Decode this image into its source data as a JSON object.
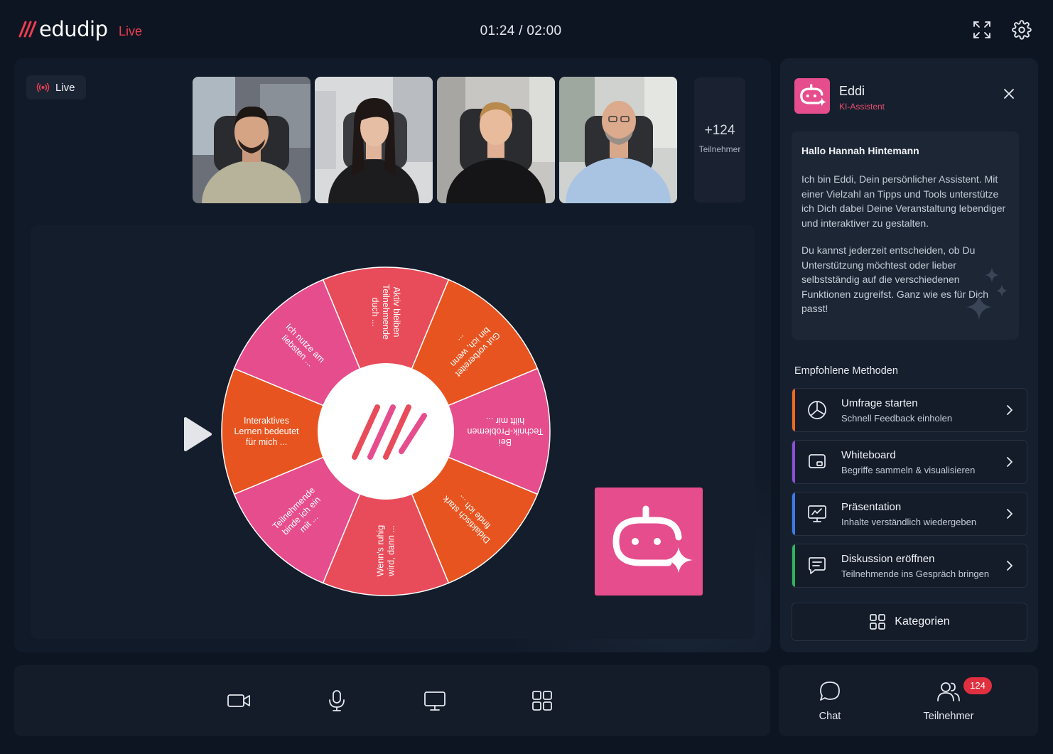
{
  "header": {
    "logo_text": "edudip",
    "live_label": "Live",
    "timer": "01:24 / 02:00",
    "fullscreen_icon": "fullscreen-icon",
    "settings_icon": "gear-icon"
  },
  "stage": {
    "live_badge": "Live",
    "more_participants": {
      "count": "+124",
      "label": "Teilnehmer"
    },
    "wheel_segments": [
      "Aktiv bleiben Teilnehmende duch ...",
      "Gut vorbereitet bin ich, wenn ...",
      "Bei Technik-Problemen hilft mir ...",
      "Didaktisch stark finde ich ...",
      "Wenn's ruhig wird, dann ...",
      "Teilnehmende binde ich ein mit ...",
      "Interaktives Lernen bedeutet für mich ...",
      "Ich nutze am liebsten ..."
    ]
  },
  "toolbar": {
    "buttons": [
      "camera-icon",
      "microphone-icon",
      "screen-share-icon",
      "apps-grid-icon"
    ]
  },
  "assistant": {
    "name": "Eddi",
    "role": "KI-Assistent",
    "greeting_title": "Hallo Hannah Hintemann",
    "greeting_p1": "Ich bin Eddi, Dein persönlicher Assistent. Mit einer Vielzahl an Tipps und Tools unterstütze ich Dich dabei Deine Veranstaltung lebendiger und interaktiver zu gestalten.",
    "greeting_p2": "Du kannst jederzeit entscheiden, ob Du Unterstützung möchtest oder lieber selbstständig auf die verschiedenen Funktionen zugreifst. Ganz wie es für Dich passt!",
    "section_title": "Empfohlene Methoden",
    "methods": [
      {
        "title": "Umfrage starten",
        "subtitle": "Schnell Feedback einholen",
        "icon": "pie-chart-icon",
        "accent": "#f06a1e"
      },
      {
        "title": "Whiteboard",
        "subtitle": "Begriffe sammeln & visualisieren",
        "icon": "whiteboard-icon",
        "accent": "#8c4fd6"
      },
      {
        "title": "Präsentation",
        "subtitle": "Inhalte verständlich wiedergeben",
        "icon": "presentation-icon",
        "accent": "#3b7be8"
      },
      {
        "title": "Diskussion eröffnen",
        "subtitle": "Teilnehmende ins Gespräch bringen",
        "icon": "chat-bubble-icon",
        "accent": "#2fb35c"
      }
    ],
    "categories_label": "Kategorien"
  },
  "bottom_right": {
    "chat_label": "Chat",
    "participants_label": "Teilnehmer",
    "participants_badge": "124"
  },
  "colors": {
    "brand_pink": "#e64d8c",
    "live_red": "#ef3d4f",
    "wheel_red": "#e84c5a",
    "wheel_orange": "#e8541f",
    "wheel_pink": "#e64d8c"
  }
}
